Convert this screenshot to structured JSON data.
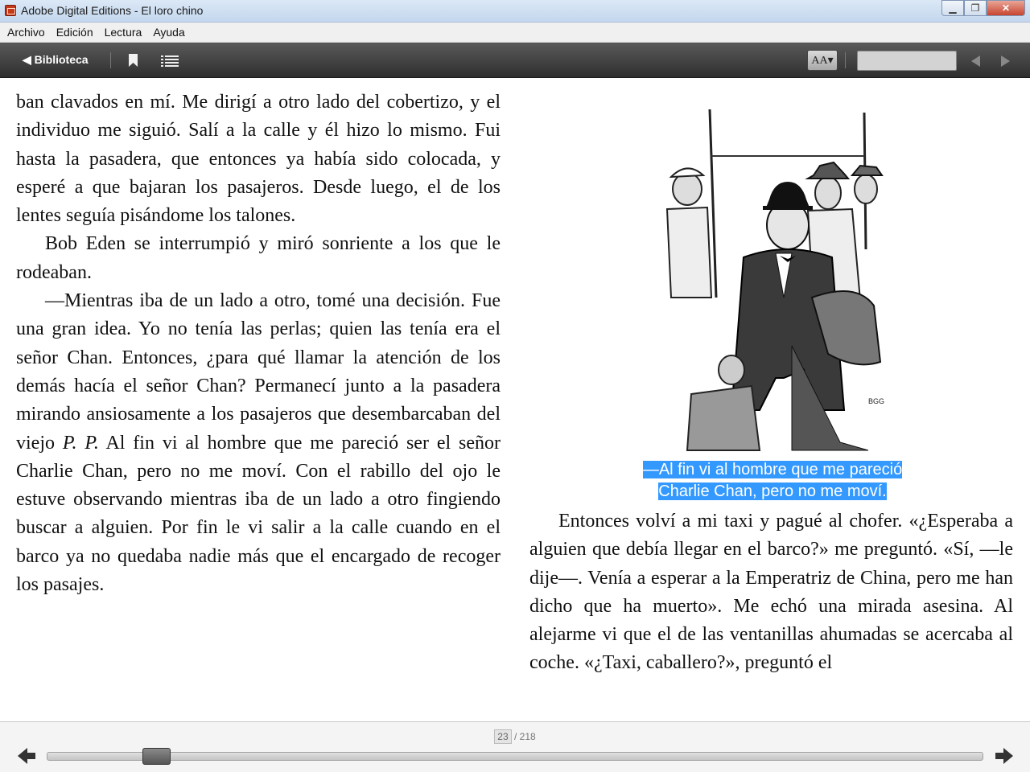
{
  "window": {
    "title": "Adobe Digital Editions - El loro chino",
    "controls": {
      "minimize": "▁",
      "maximize": "❐",
      "close": "✕"
    }
  },
  "menu": [
    "Archivo",
    "Edición",
    "Lectura",
    "Ayuda"
  ],
  "toolbar": {
    "library_label": "◀ Biblioteca",
    "font_size_label": "AA▾",
    "search_value": "",
    "icons": [
      "bookmark-icon",
      "toc-icon",
      "prev-page-icon",
      "next-page-icon"
    ]
  },
  "book": {
    "left_paragraphs": [
      "ban clavados en mí. Me dirigí a otro lado del cobertizo, y el individuo me siguió. Salí a la calle y él hizo lo mismo. Fui hasta la pasadera, que entonces ya había sido colocada, y esperé a que bajaran los pasajeros. Desde luego, el de los lentes seguía pisándome los talones.",
      "Bob Eden se interrumpió y miró sonriente a los que le rodeaban.",
      "—Mientras iba de un lado a otro, tomé una decisión. Fue una gran idea. Yo no tenía las perlas; quien las tenía era el señor Chan. Entonces, ¿para qué llamar la atención de los demás hacía el señor Chan? Permanecí junto a la pasadera mirando ansiosamente a los pasajeros que desembarcaban del viejo ",
      "P. P.",
      " Al fin vi al hombre que me pareció ser el señor Charlie Chan, pero no me moví. Con el rabillo del ojo le estuve observando mientras iba de un lado a otro fingiendo buscar a alguien. Por fin le vi salir a la calle cuando en el barco ya no quedaba nadie más que el encargado de recoger los pasajes."
    ],
    "caption_line1": "—Al fin vi al hombre que me pareció",
    "caption_line2": "Charlie Chan, pero no me moví.",
    "right_paragraph": "Entonces volví a mi taxi y pagué al chofer. «¿Esperaba a alguien que debía llegar en el barco?» me preguntó. «Sí, —le dije—. Venía a esperar a la Emperatriz de China, pero me han dicho que ha muerto». Me echó una mirada asesina. Al alejarme vi que el de las ventanillas ahumadas se acercaba al coche. «¿Taxi, caballero?», preguntó el"
  },
  "pagination": {
    "current": "23",
    "total": "/ 218",
    "progress_fraction": 0.105
  },
  "colors": {
    "selection": "#3399ff",
    "toolbar": "#3f3f3f"
  }
}
